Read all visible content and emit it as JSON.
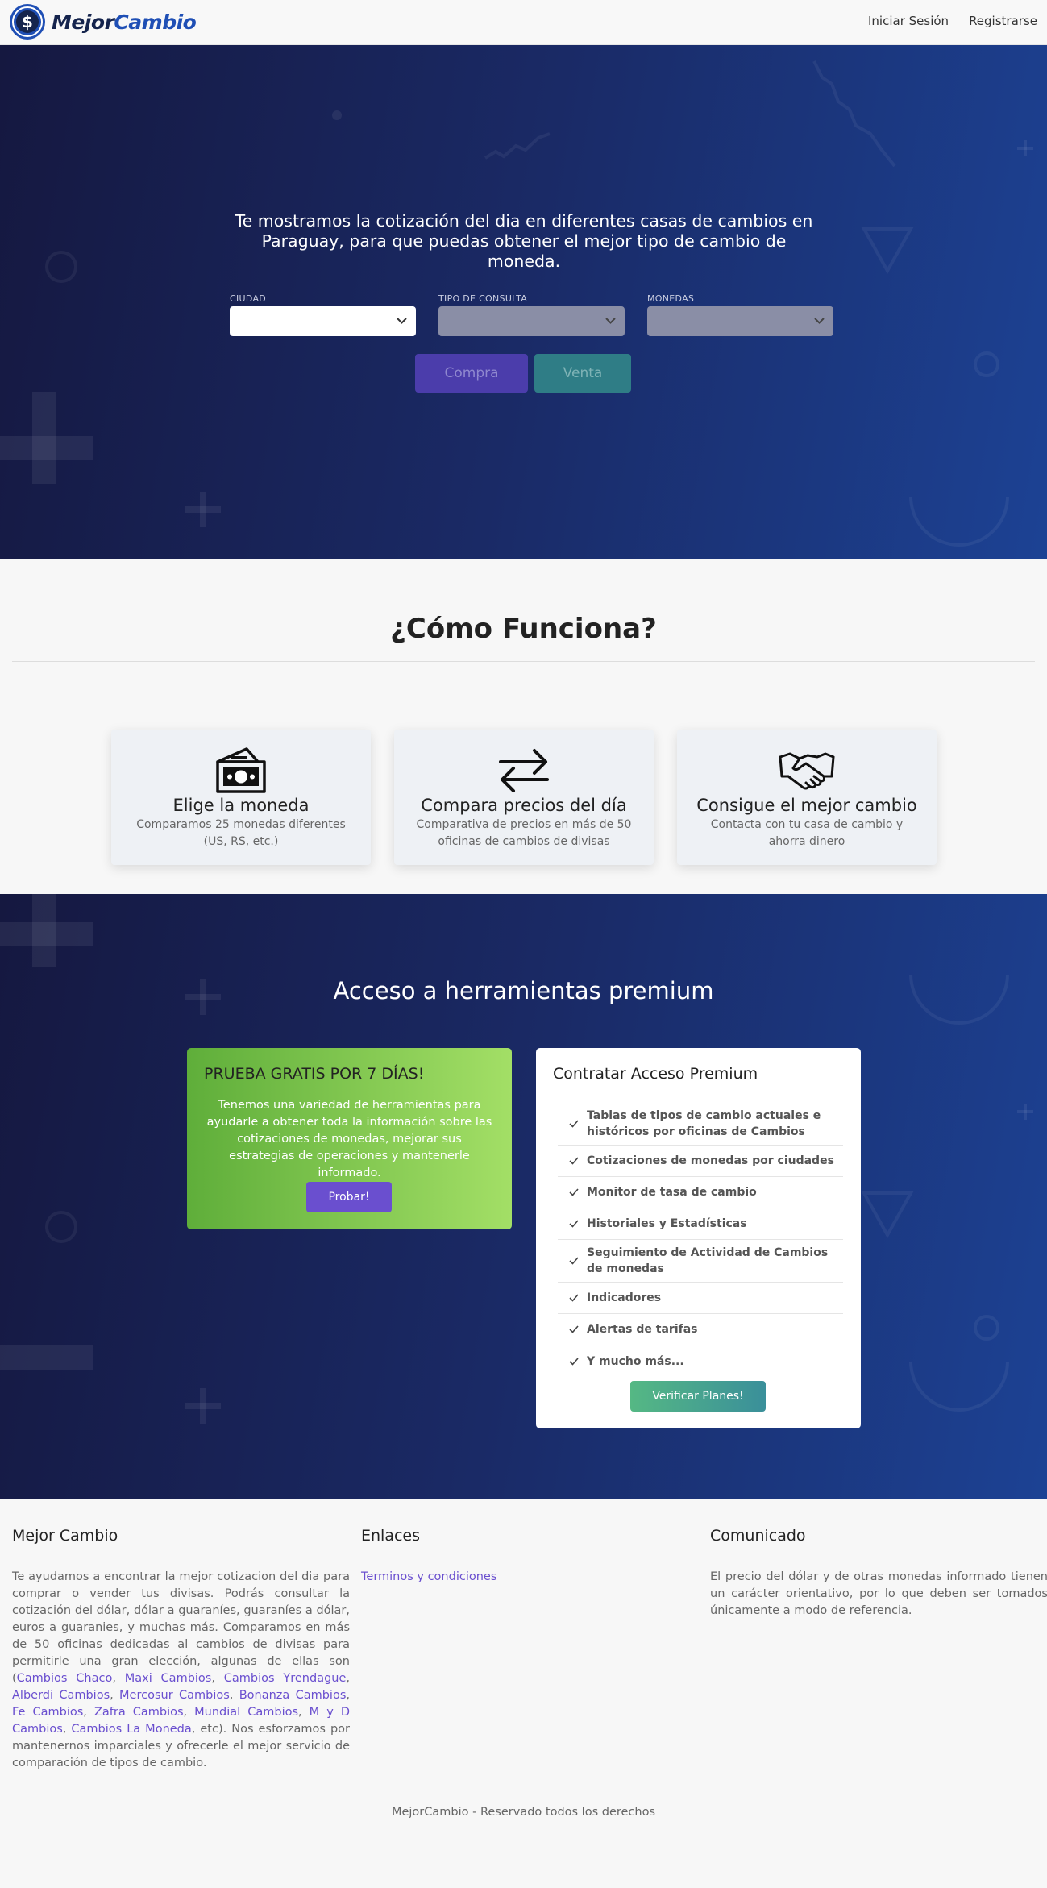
{
  "brand": {
    "name_part1": "Mejor",
    "name_part2": "Cambio"
  },
  "nav": {
    "login": "Iniciar Sesión",
    "register": "Registrarse"
  },
  "hero": {
    "title": "Te mostramos la cotización del dia en diferentes casas de cambios en Paraguay, para que puedas obtener el mejor tipo de cambio de moneda.",
    "fields": [
      {
        "label": "CIUDAD",
        "value": ""
      },
      {
        "label": "TIPO DE CONSULTA",
        "value": ""
      },
      {
        "label": "MONEDAS",
        "value": ""
      }
    ],
    "buy_label": "Compra",
    "sell_label": "Venta"
  },
  "how": {
    "title": "¿Cómo Funciona?",
    "cards": [
      {
        "icon": "money-icon",
        "title": "Elige la moneda",
        "text": "Comparamos 25 monedas diferentes (US, RS, etc.)"
      },
      {
        "icon": "exchange-arrows-icon",
        "title": "Compara precios del día",
        "text": "Comparativa de precios en más de 50 oficinas de cambios de divisas"
      },
      {
        "icon": "handshake-icon",
        "title": "Consigue el mejor cambio",
        "text": "Contacta con tu casa de cambio y ahorra dinero"
      }
    ]
  },
  "premium": {
    "title": "Acceso a herramientas premium",
    "trial": {
      "title": "PRUEBA GRATIS POR 7 DÍAS!",
      "text": "Tenemos una variedad de herramientas para ayudarle a obtener toda la información sobre las cotizaciones de monedas, mejorar sus estrategias de operaciones y mantenerle informado.",
      "button": "Probar!"
    },
    "plan": {
      "title": "Contratar Acceso Premium",
      "items": [
        "Tablas de tipos de cambio actuales e históricos por oficinas de Cambios",
        "Cotizaciones de monedas por ciudades",
        "Monitor de tasa de cambio",
        "Historiales y Estadísticas",
        "Seguimiento de Actividad de Cambios de monedas",
        "Indicadores",
        "Alertas de tarifas",
        "Y mucho más..."
      ],
      "button": "Verificar Planes!"
    }
  },
  "footer": {
    "about": {
      "title": "Mejor Cambio",
      "text_before": "Te ayudamos a encontrar la mejor cotizacion del dia para comprar o vender tus divisas. Podrás consultar la cotización del dólar, dólar a guaraníes, guaraníes a dólar, euros a guaranies, y muchas más. Comparamos en más de 50 oficinas dedicadas al cambios de divisas para permitirle una gran elección, algunas de ellas son (",
      "links": [
        "Cambios Chaco",
        "Maxi Cambios",
        "Cambios Yrendague",
        "Alberdi Cambios",
        "Mercosur Cambios",
        "Bonanza Cambios",
        "Fe Cambios",
        "Zafra Cambios",
        "Mundial Cambios",
        "M y D Cambios",
        "Cambios La Moneda"
      ],
      "text_after": ", etc). Nos esforzamos por mantenernos imparciales y ofrecerle el mejor servicio de comparación de tipos de cambio."
    },
    "links": {
      "title": "Enlaces",
      "terms": "Terminos y condiciones"
    },
    "notice": {
      "title": "Comunicado",
      "text": "El precio del dólar y de otras monedas informado tienen un carácter orientativo, por lo que deben ser tomados únicamente a modo de referencia."
    },
    "copyright": "MejorCambio - Reservado todos los derechos"
  }
}
